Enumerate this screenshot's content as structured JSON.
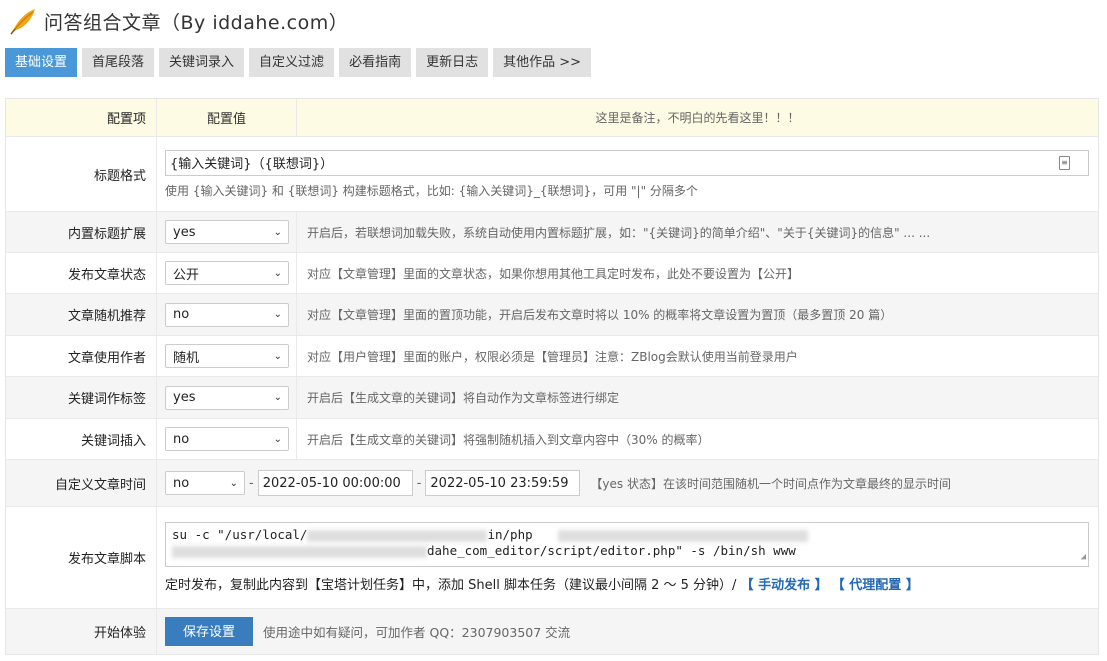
{
  "header": {
    "title": "问答组合文章（By iddahe.com）",
    "logo_icon": "feather-icon"
  },
  "tabs": [
    "基础设置",
    "首尾段落",
    "关键词录入",
    "自定义过滤",
    "必看指南",
    "更新日志",
    "其他作品 >>"
  ],
  "table": {
    "col_item": "配置项",
    "col_value": "配置值",
    "col_note": "这里是备注，不明白的先看这里！！！"
  },
  "title_format": {
    "label": "标题格式",
    "value": "{输入关键词}（{联想词}）",
    "hint": "使用 {输入关键词} 和 {联想词} 构建标题格式，比如: {输入关键词}_{联想词}，可用 \"|\" 分隔多个"
  },
  "rows": [
    {
      "label": "内置标题扩展",
      "value": "yes",
      "desc": "开启后，若联想词加载失败，系统自动使用内置标题扩展，如：\"{关键词}的简单介绍\"、\"关于{关键词}的信息\" ... ..."
    },
    {
      "label": "发布文章状态",
      "value": "公开",
      "desc": "对应【文章管理】里面的文章状态，如果你想用其他工具定时发布，此处不要设置为【公开】"
    },
    {
      "label": "文章随机推荐",
      "value": "no",
      "desc": "对应【文章管理】里面的置顶功能，开启后发布文章时将以 10% 的概率将文章设置为置顶（最多置顶 20 篇）"
    },
    {
      "label": "文章使用作者",
      "value": "随机",
      "desc": "对应【用户管理】里面的账户，权限必须是【管理员】注意：ZBlog会默认使用当前登录用户"
    },
    {
      "label": "关键词作标签",
      "value": "yes",
      "desc": "开启后【生成文章的关键词】将自动作为文章标签进行绑定"
    },
    {
      "label": "关键词插入",
      "value": "no",
      "desc": "开启后【生成文章的关键词】将强制随机插入到文章内容中（30% 的概率）"
    }
  ],
  "custom_time": {
    "label": "自定义文章时间",
    "toggle": "no",
    "dash": "-",
    "start": "2022-05-10 00:00:00",
    "end": "2022-05-10 23:59:59",
    "desc": "【yes 状态】在该时间范围随机一个时间点作为文章最终的显示时间"
  },
  "script": {
    "label": "发布文章脚本",
    "line1_a": "su -c \"/usr/local/",
    "line1_b": "in/php",
    "line2_b": "dahe_com_editor/script/editor.php\" -s /bin/sh www",
    "hint": "定时发布，复制此内容到【宝塔计划任务】中，添加 Shell 脚本任务（建议最小间隔 2 ～ 5 分钟）/",
    "link_manual": "【 手动发布 】",
    "link_proxy": "【 代理配置 】"
  },
  "start": {
    "label": "开始体验",
    "save": "保存设置",
    "desc": "使用途中如有疑问，可加作者 QQ：2307903507 交流"
  },
  "colors": {
    "accent": "#4a98d8",
    "header_bg": "#fdfbe3",
    "link": "#2469b3"
  }
}
